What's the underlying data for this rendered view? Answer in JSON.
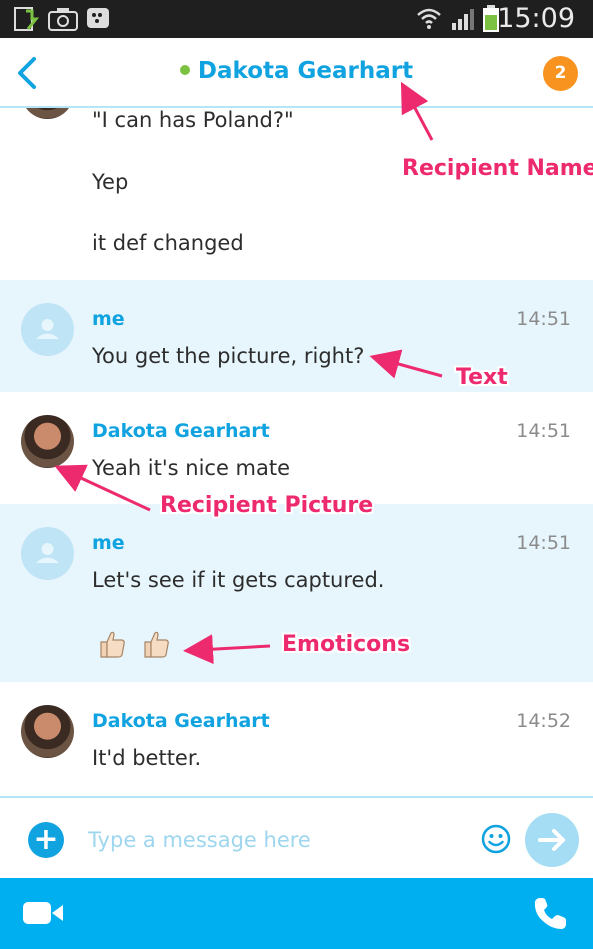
{
  "status_bar": {
    "time": "15:09"
  },
  "header": {
    "contact_name": "Dakota Gearhart",
    "notification_count": "2"
  },
  "messages": [
    {
      "lines": [
        "\"I can has Poland?\"",
        "Yep",
        "it def changed"
      ]
    },
    {
      "sender": "me",
      "time": "14:51",
      "text": "You get the picture, right?"
    },
    {
      "sender": "Dakota Gearhart",
      "time": "14:51",
      "text": "Yeah it's nice mate"
    },
    {
      "sender": "me",
      "time": "14:51",
      "text": "Let's see if it gets captured."
    },
    {
      "sender": "Dakota Gearhart",
      "time": "14:52",
      "text": "It'd better."
    }
  ],
  "annotations": {
    "recipient_name": "Recipient Name",
    "text": "Text",
    "recipient_picture": "Recipient Picture",
    "emoticons": "Emoticons"
  },
  "composer": {
    "placeholder": "Type a message here"
  },
  "icons": {
    "back": "chevron-left-icon",
    "add": "plus-icon",
    "emoji": "smiley-icon",
    "send": "arrow-right-icon",
    "video": "video-camera-icon",
    "call": "phone-icon",
    "emoticon": "thumbs-up-icon"
  },
  "colors": {
    "accent": "#00aff0",
    "name": "#10a3e0",
    "badge": "#f7931e",
    "annotation": "#ee2a6f",
    "me_bubble": "#e7f6fd"
  }
}
